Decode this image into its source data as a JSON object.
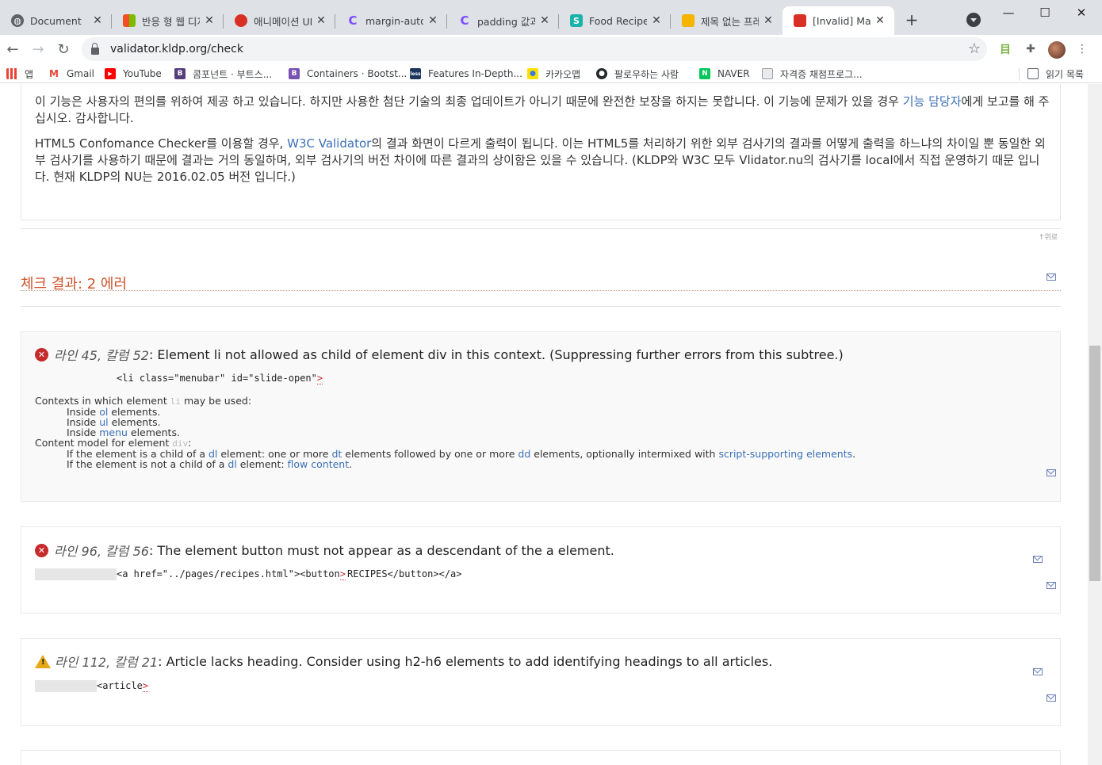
{
  "browser": {
    "tabs": [
      {
        "title": "Document",
        "fav": "globe-icon",
        "color": "#5f6368"
      },
      {
        "title": "반응 형 웹 디자",
        "fav": "windows-icon",
        "color": "#f25022"
      },
      {
        "title": "애니메이션 UI",
        "fav": "tomato-icon",
        "color": "#d93025"
      },
      {
        "title": "margin-auto; -",
        "fav": "c-logo-icon",
        "color": "#7c4dff"
      },
      {
        "title": "padding 값과",
        "fav": "c-logo-icon",
        "color": "#7c4dff"
      },
      {
        "title": "Food Recipes",
        "fav": "s-logo-icon",
        "color": "#1bb3a8"
      },
      {
        "title": "제목 없는 프레",
        "fav": "slides-icon",
        "color": "#f4b400"
      },
      {
        "title": "[Invalid] Mark",
        "fav": "validator-icon",
        "color": "#d93025",
        "active": true
      }
    ],
    "url": "validator.kldp.org/check",
    "bookmarks": [
      {
        "label": "앱",
        "fav": "apps-grid-icon",
        "color": "#ea4335"
      },
      {
        "label": "Gmail",
        "fav": "gmail-icon",
        "color": "#ea4335"
      },
      {
        "label": "YouTube",
        "fav": "youtube-icon",
        "color": "#ff0000"
      },
      {
        "label": "콤포넌트 · 부트스...",
        "fav": "bootstrap-icon",
        "color": "#563d7c"
      },
      {
        "label": "Containers · Bootst...",
        "fav": "bootstrap-icon",
        "color": "#7952b3"
      },
      {
        "label": "Features In-Depth...",
        "fav": "less-icon",
        "color": "#1d365d"
      },
      {
        "label": "카카오맵",
        "fav": "kakaomap-icon",
        "color": "#fae100"
      },
      {
        "label": "팔로우하는 사람",
        "fav": "github-icon",
        "color": "#24292e"
      },
      {
        "label": "NAVER",
        "fav": "naver-icon",
        "color": "#03c75a"
      },
      {
        "label": "자격증 채점프로그...",
        "fav": "document-icon",
        "color": "#9aa0a6"
      }
    ],
    "reading_list": "읽기 목록"
  },
  "notice": {
    "p1_a": "이 기능은 사용자의 편의를 위하여 제공 하고 있습니다. 하지만 사용한 첨단 기술의 최종 업데이트가 아니기 때문에 완전한 보장을 하지는 못합니다. 이 기능에 문제가 있을 경우 ",
    "p1_link": "기능 담당자",
    "p1_b": "에게 보고를 해 주십시오. 감사합니다.",
    "p2_a": "HTML5 Confomance Checker를 이용할 경우, ",
    "p2_link": "W3C Validator",
    "p2_b": "의 결과 화면이 다르게 출력이 됩니다. 이는 HTML5를 처리하기 위한 외부 검사기의 결과를 어떻게 출력을 하느냐의 차이일 뿐 동일한 외부 검사기를 사용하기 때문에 결과는 거의 동일하며, 외부 검사기의 버전 차이에 따른 결과의 상이함은 있을 수 있습니다. (KLDP와 W3C 모두 Vlidator.nu의 검사기를 local에서 직접 운영하기 때문 입니다. 현재 KLDP의 NU는 2016.02.05 버전 입니다.)",
    "to_top": "↑위로"
  },
  "result": {
    "title": "체크 결과: 2 에러"
  },
  "messages": [
    {
      "type": "error",
      "location": "라인 45, 칼럼 52",
      "text": ": Element li not allowed as child of element div in this context. (Suppressing further errors from this subtree.)",
      "code_before": "<li class=\"menubar\" id=\"slide-open\"",
      "code_mark": ">",
      "code_after": "",
      "ctx_l1_a": "Contexts in which element ",
      "ctx_l1_code": "li",
      "ctx_l1_b": " may be used:",
      "ctx_l2_a": "Inside ",
      "ctx_l2_link": "ol",
      "ctx_l2_b": " elements.",
      "ctx_l3_a": "Inside ",
      "ctx_l3_link": "ul",
      "ctx_l3_b": " elements.",
      "ctx_l4_a": "Inside ",
      "ctx_l4_link": "menu",
      "ctx_l4_b": " elements.",
      "ctx_l5_a": "Content model for element ",
      "ctx_l5_code": "div",
      "ctx_l5_b": ":",
      "ctx_l6_a": "If the element is a child of a ",
      "ctx_l6_link1": "dl",
      "ctx_l6_b": " element: one or more ",
      "ctx_l6_link2": "dt",
      "ctx_l6_c": " elements followed by one or more ",
      "ctx_l6_link3": "dd",
      "ctx_l6_d": " elements, optionally intermixed with ",
      "ctx_l6_link4": "script-supporting elements",
      "ctx_l6_e": ".",
      "ctx_l7_a": "If the element is not a child of a ",
      "ctx_l7_link1": "dl",
      "ctx_l7_b": " element: ",
      "ctx_l7_link2": "flow content",
      "ctx_l7_c": "."
    },
    {
      "type": "error",
      "location": "라인 96, 칼럼 56",
      "text": ": The element button must not appear as a descendant of the a element.",
      "code_before": "<a href=\"../pages/recipes.html\"><button",
      "code_mark": ">",
      "code_after": "RECIPES</button></a>"
    },
    {
      "type": "warning",
      "location": "라인 112, 칼럼 21",
      "text": ": Article lacks heading. Consider using h2-h6 elements to add identifying headings to all articles.",
      "code_before": "<article",
      "code_mark": ">",
      "code_after": ""
    }
  ]
}
